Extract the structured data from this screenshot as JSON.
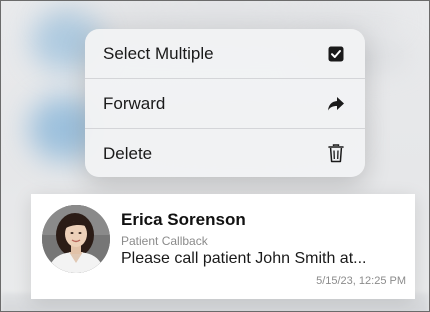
{
  "context_menu": {
    "items": [
      {
        "label": "Select Multiple",
        "icon": "checkbox-icon"
      },
      {
        "label": "Forward",
        "icon": "forward-arrow-icon"
      },
      {
        "label": "Delete",
        "icon": "trash-icon"
      }
    ]
  },
  "message": {
    "sender": "Erica Sorenson",
    "category": "Patient Callback",
    "preview": "Please call patient John Smith at...",
    "timestamp": "5/15/23, 12:25 PM",
    "avatar": "avatar-photo"
  },
  "colors": {
    "menu_background": "#f1f2f4",
    "divider": "#d4d5d8",
    "primary_text": "#1a1a1a",
    "secondary_text": "#8b8b8b",
    "backdrop_accent": "#6aa6d4"
  }
}
